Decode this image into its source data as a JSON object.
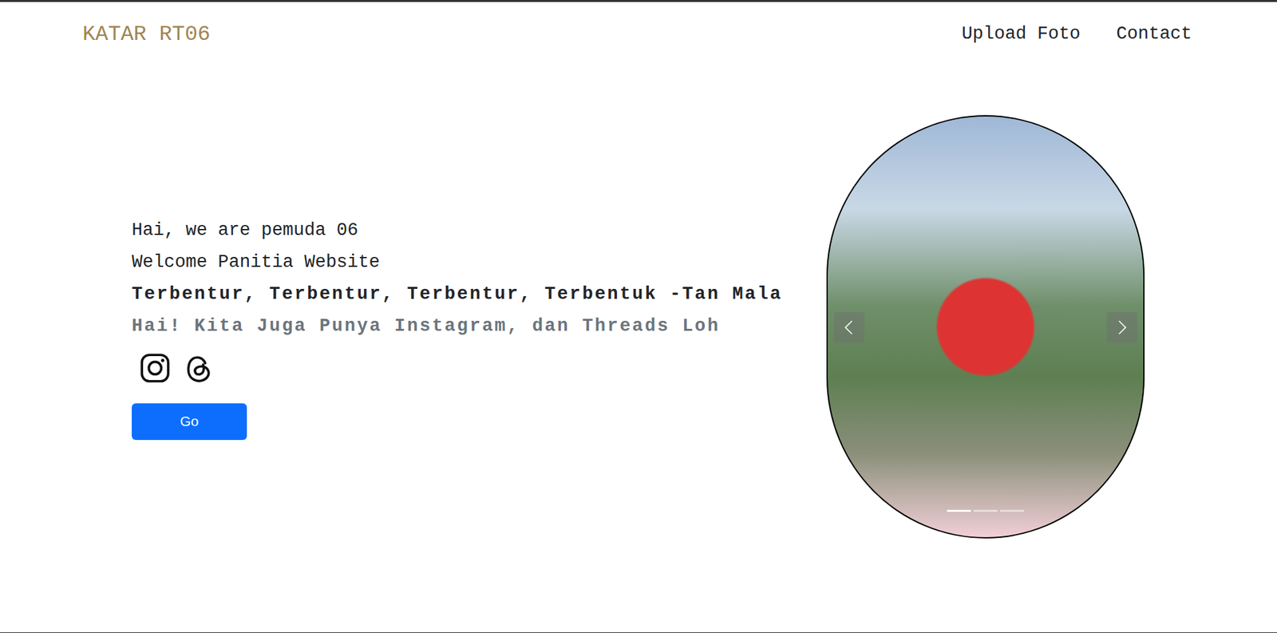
{
  "navbar": {
    "brand": "KATAR RT06",
    "links": [
      "Upload Foto",
      "Contact"
    ]
  },
  "hero": {
    "lines": [
      "Hai, we are pemuda 06",
      "Welcome Panitia Website"
    ],
    "quote": "Terbentur, Terbentur, Terbentur, Terbentuk -Tan Mala",
    "social_prompt": "Hai! Kita Juga Punya Instagram, dan Threads Loh",
    "button": "Go"
  },
  "carousel": {
    "slides": [
      {
        "selected": true
      },
      {
        "selected": false
      },
      {
        "selected": false
      }
    ]
  }
}
